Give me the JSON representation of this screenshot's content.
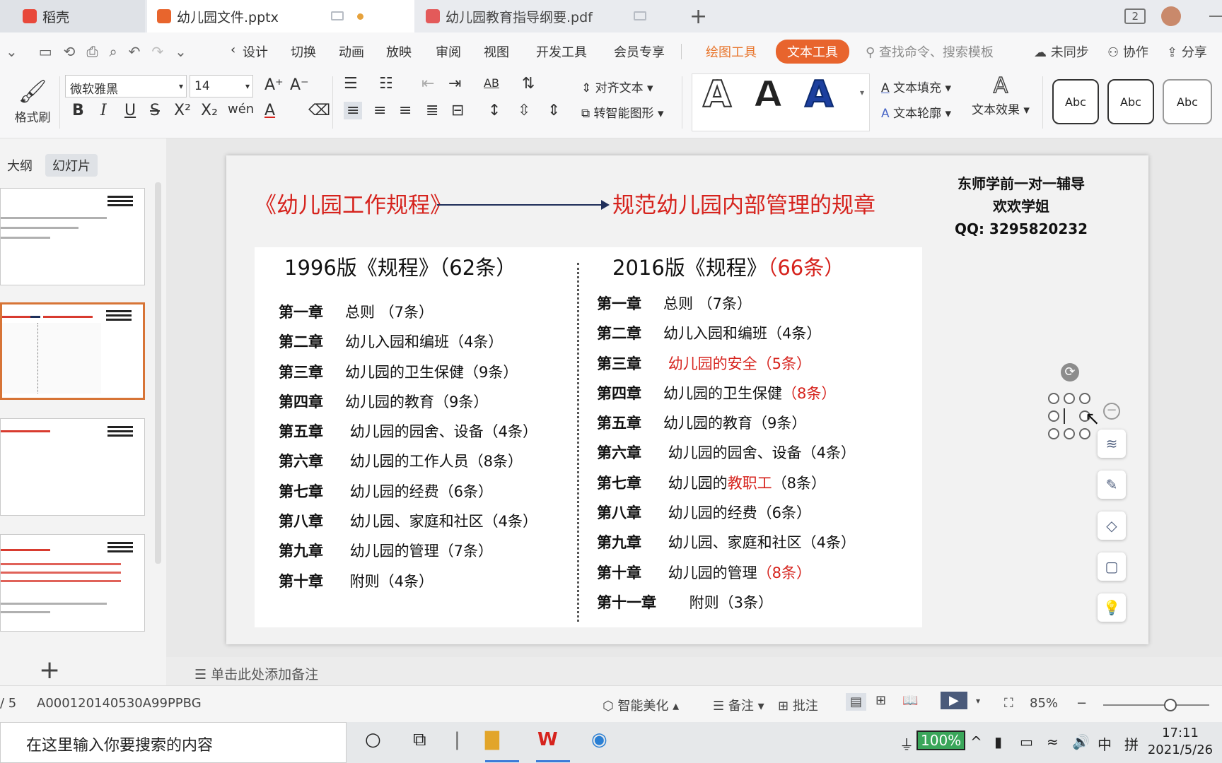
{
  "tabs": [
    {
      "label": "稻壳"
    },
    {
      "label": "幼儿园文件.pptx"
    },
    {
      "label": "幼儿园教育指导纲要.pdf"
    }
  ],
  "window": {
    "badge": "2"
  },
  "menu": {
    "items": [
      "设计",
      "切换",
      "动画",
      "放映",
      "审阅",
      "视图",
      "开发工具",
      "会员专享"
    ],
    "draw_tools": "绘图工具",
    "text_tools": "文本工具",
    "search_placeholder": "查找命令、搜索模板",
    "sync": "未同步",
    "collab": "协作",
    "share": "分享"
  },
  "ribbon": {
    "format_painter": "格式刷",
    "font_name": "微软雅黑",
    "font_size": "14",
    "align_text": "对齐文本",
    "smart_shape": "转智能图形",
    "text_fill": "文本填充",
    "text_outline": "文本轮廓",
    "text_effect": "文本效果",
    "styles": [
      "Abc",
      "Abc",
      "Abc"
    ]
  },
  "left_panel": {
    "tab_outline": "大纲",
    "tab_slides": "幻灯片"
  },
  "slide": {
    "title_left": "《幼儿园工作规程》",
    "title_right": "规范幼儿园内部管理的规章",
    "watermark": [
      "东师学前一对一辅导",
      "欢欢学姐",
      "QQ:  3295820232"
    ],
    "head_1996": "1996版《规程》（62条）",
    "head_2016_a": "2016版《规程》",
    "head_2016_b": "（66条）",
    "chapters_1996": [
      {
        "num": "第一章",
        "text": "总则   （7条）"
      },
      {
        "num": "第二章",
        "text": "幼儿入园和编班（4条）"
      },
      {
        "num": "第三章",
        "text": "幼儿园的卫生保健（9条）"
      },
      {
        "num": "第四章",
        "text": "幼儿园的教育（9条）"
      },
      {
        "num": "第五章",
        "text": " 幼儿园的园舍、设备（4条）"
      },
      {
        "num": "第六章",
        "text": " 幼儿园的工作人员（8条）"
      },
      {
        "num": "第七章",
        "text": " 幼儿园的经费（6条）"
      },
      {
        "num": "第八章",
        "text": " 幼儿园、家庭和社区（4条）"
      },
      {
        "num": "第九章",
        "text": " 幼儿园的管理（7条）"
      },
      {
        "num": "第十章",
        "text": " 附则（4条）"
      }
    ],
    "chapters_2016": [
      {
        "num": "第一章",
        "a": "总则   （7条）",
        "r": "",
        "b": ""
      },
      {
        "num": "第二章",
        "a": "幼儿入园和编班（4条）",
        "r": "",
        "b": ""
      },
      {
        "num": "第三章",
        "a": " ",
        "r": "幼儿园的安全（5条）",
        "b": ""
      },
      {
        "num": "第四章",
        "a": "幼儿园的卫生保健",
        "r": "（8条）",
        "b": ""
      },
      {
        "num": "第五章",
        "a": "幼儿园的教育（9条）",
        "r": "",
        "b": ""
      },
      {
        "num": "第六章",
        "a": " 幼儿园的园舍、设备（4条）",
        "r": "",
        "b": ""
      },
      {
        "num": "第七章",
        "a": " 幼儿园的",
        "r": "教职工",
        "b": "（8条）"
      },
      {
        "num": "第八章",
        "a": " 幼儿园的经费（6条）",
        "r": "",
        "b": ""
      },
      {
        "num": "第九章",
        "a": " 幼儿园、家庭和社区（4条）",
        "r": "",
        "b": ""
      },
      {
        "num": "第十章",
        "a": " 幼儿园的管理",
        "r": "（8条）",
        "b": ""
      },
      {
        "num": "第十一章",
        "a": " 附则（3条）",
        "r": "",
        "b": ""
      }
    ]
  },
  "notes": {
    "placeholder": "单击此处添加备注"
  },
  "status": {
    "page": "/ 5",
    "doc_id": "A000120140530A99PPBG",
    "beautify": "智能美化",
    "notes": "备注",
    "comment": "批注",
    "zoom": "85%"
  },
  "taskbar": {
    "search_placeholder": "在这里输入你要搜索的内容",
    "battery": "100%",
    "ime": "中",
    "ime2": "拼",
    "time": "17:11",
    "date": "2021/5/26"
  },
  "colors": {
    "accent": "#e8642d",
    "title_red": "#d6231d"
  }
}
